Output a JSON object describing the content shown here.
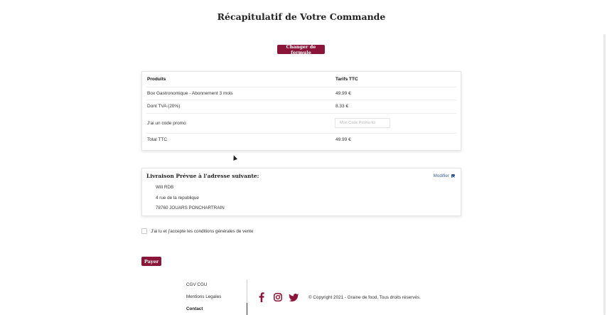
{
  "page": {
    "title": "Récapitulatif de Votre Commande"
  },
  "actions": {
    "change_formula": "Changer de formule",
    "pay": "Payer"
  },
  "order": {
    "headers": {
      "product": "Produits",
      "price": "Tarifs TTC"
    },
    "rows": [
      {
        "label": "Box Gastronomique - Abonnement 3 mois",
        "value": "49.99 €"
      },
      {
        "label": "Dont TVA (20%)",
        "value": "8.33 €"
      }
    ],
    "promo": {
      "label": "J'ai un code promo",
      "placeholder": "Mon Code Promo Ici"
    },
    "total": {
      "label": "Total TTC",
      "value": "49.99 €"
    }
  },
  "delivery": {
    "title": "Livraison Prévue à l'adresse suivante:",
    "modify_label": "Modifier",
    "name": "Will RDB",
    "street": "4 rue de la republique",
    "city": "78760 JOUARS PONCHARTRAIN"
  },
  "terms": {
    "label": "J'ai lu et j'accepte les conditions générales de vente",
    "checked": false
  },
  "footer": {
    "links": [
      "CGV CGU",
      "Mentions Legales",
      "Contact"
    ],
    "social": [
      "facebook-icon",
      "instagram-icon",
      "twitter-icon"
    ],
    "copyright": "© Copyright 2021 - Graine de food, Tous droits réservés."
  },
  "colors": {
    "brand": "#8a1538",
    "link": "#3a5f8f"
  }
}
